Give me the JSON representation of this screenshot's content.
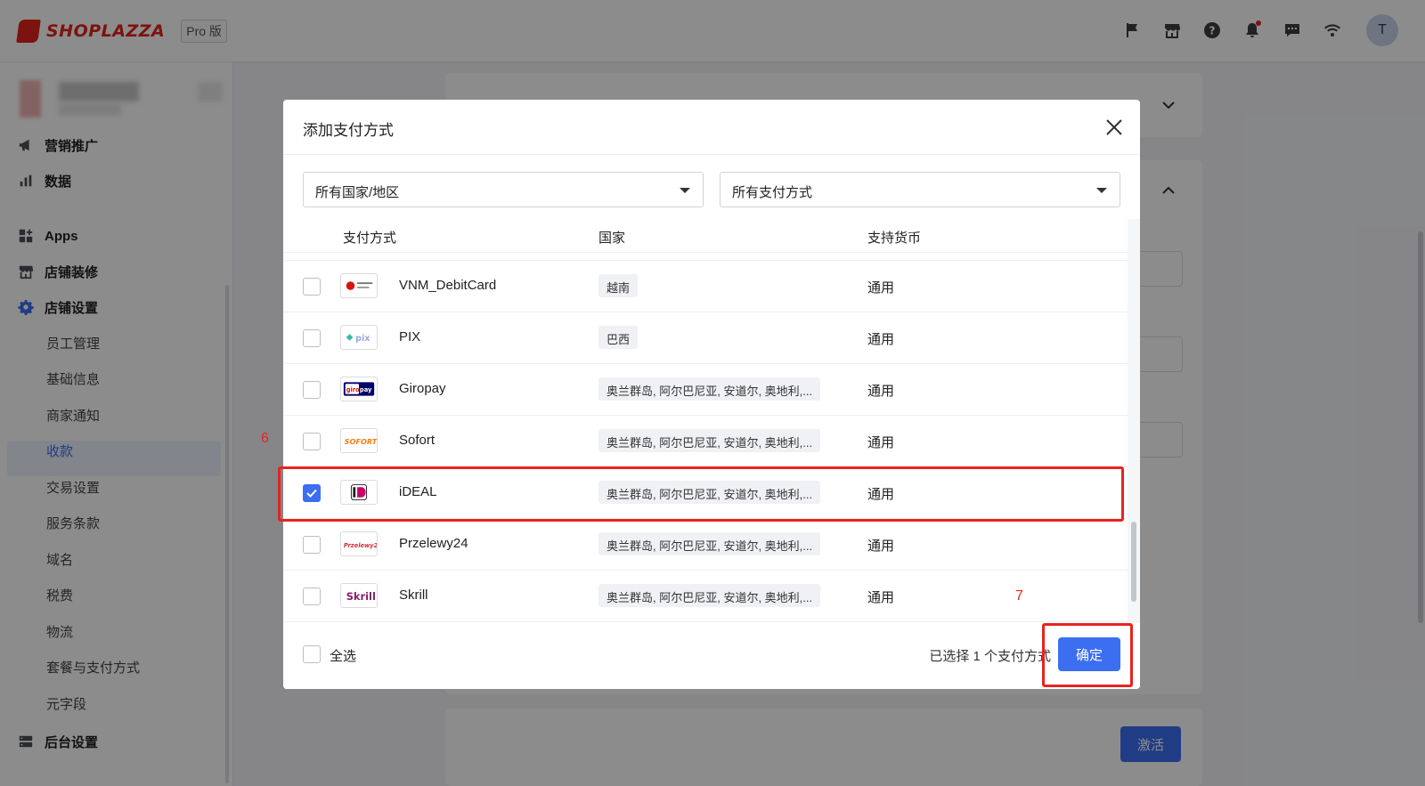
{
  "header": {
    "brand": "SHOPLAZZA",
    "plan_badge": "Pro 版",
    "icons": [
      "flag-icon",
      "store-icon",
      "help-icon",
      "bell-icon",
      "chat-icon",
      "wifi-icon"
    ],
    "avatar_initial": "T"
  },
  "sidebar": {
    "items": [
      {
        "label": "营销推广",
        "icon": "megaphone-icon"
      },
      {
        "label": "数据",
        "icon": "bar-chart-icon"
      },
      {
        "label": "Apps",
        "icon": "apps-icon"
      },
      {
        "label": "店铺装修",
        "icon": "store-icon"
      },
      {
        "label": "店铺设置",
        "icon": "gear-icon"
      }
    ],
    "sub_items": [
      "员工管理",
      "基础信息",
      "商家通知",
      "收款",
      "交易设置",
      "服务条款",
      "域名",
      "税费",
      "物流",
      "套餐与支付方式",
      "元字段"
    ],
    "active_sub_item": "收款",
    "bottom_item": {
      "label": "后台设置",
      "icon": "server-icon"
    }
  },
  "page": {
    "activate_label": "激活"
  },
  "modal": {
    "title": "添加支付方式",
    "country_filter": "所有国家/地区",
    "method_filter": "所有支付方式",
    "columns": [
      "支付方式",
      "国家",
      "支持货币"
    ],
    "rows": [
      {
        "name": "VNM_DebitCard",
        "countries": "越南",
        "currency": "通用",
        "checked": false,
        "logo": "vnm-debitcard-logo"
      },
      {
        "name": "PIX",
        "countries": "巴西",
        "currency": "通用",
        "checked": false,
        "logo": "pix-logo"
      },
      {
        "name": "Giropay",
        "countries": "奥兰群岛, 阿尔巴尼亚, 安道尔, 奥地利,...",
        "currency": "通用",
        "checked": false,
        "logo": "giropay-logo"
      },
      {
        "name": "Sofort",
        "countries": "奥兰群岛, 阿尔巴尼亚, 安道尔, 奥地利,...",
        "currency": "通用",
        "checked": false,
        "logo": "sofort-logo"
      },
      {
        "name": "iDEAL",
        "countries": "奥兰群岛, 阿尔巴尼亚, 安道尔, 奥地利,...",
        "currency": "通用",
        "checked": true,
        "logo": "ideal-logo"
      },
      {
        "name": "Przelewy24",
        "countries": "奥兰群岛, 阿尔巴尼亚, 安道尔, 奥地利,...",
        "currency": "通用",
        "checked": false,
        "logo": "przelewy24-logo"
      },
      {
        "name": "Skrill",
        "countries": "奥兰群岛, 阿尔巴尼亚, 安道尔, 奥地利,...",
        "currency": "通用",
        "checked": false,
        "logo": "skrill-logo"
      }
    ],
    "select_all_label": "全选",
    "selected_count_text": "已选择 1 个支付方式",
    "confirm_label": "确定"
  },
  "annotations": {
    "step_6": "6",
    "step_7": "7",
    "color": "#e8231e"
  },
  "colors": {
    "primary": "#3b6ef0",
    "brand": "#e2231a"
  }
}
